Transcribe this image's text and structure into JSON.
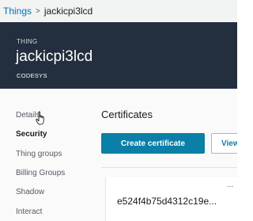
{
  "breadcrumb": {
    "parent": "Things",
    "separator": ">",
    "current": "jackicpi3lcd"
  },
  "header": {
    "type_label": "THING",
    "thing_name": "jackicpi3lcd",
    "subtitle": "CODESYS"
  },
  "sidebar": {
    "items": [
      {
        "label": "Details"
      },
      {
        "label": "Security"
      },
      {
        "label": "Thing groups"
      },
      {
        "label": "Billing Groups"
      },
      {
        "label": "Shadow"
      },
      {
        "label": "Interact"
      }
    ],
    "active": "Security"
  },
  "main": {
    "section_title": "Certificates",
    "create_button": "Create certificate",
    "view_button": "View oth",
    "certificate": {
      "id": "e524f4b75d4312c19e...",
      "menu": "..."
    }
  },
  "colors": {
    "header_bg": "#232f3e",
    "primary_button": "#0a7fa8",
    "link": "#0073bb"
  }
}
